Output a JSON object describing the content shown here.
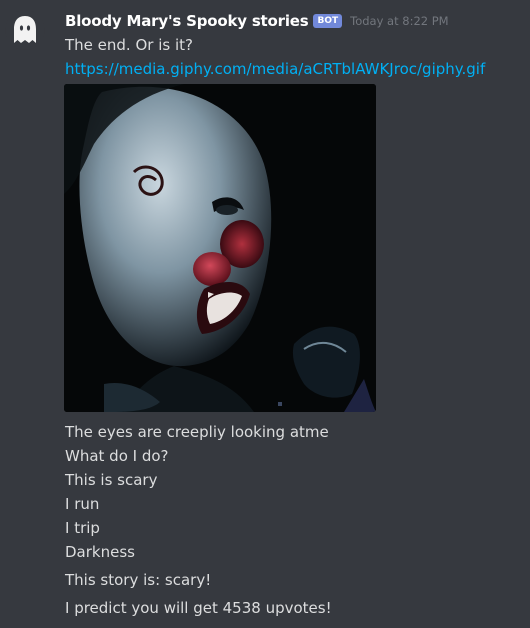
{
  "message": {
    "author": "Bloody Mary's Spooky stories",
    "bot_tag": "BOT",
    "timestamp": "Today at 8:22 PM",
    "text_line": "The end. Or is it?",
    "link": "https://media.giphy.com/media/aCRTblAWKJroc/giphy.gif",
    "story_lines": [
      "The eyes are creepliy looking atme",
      "What do I do?",
      "This is scary",
      "I run",
      "I trip",
      "Darkness"
    ],
    "verdict": "This story is: scary!",
    "prediction": "I predict you will get 4538 upvotes!"
  },
  "colors": {
    "background": "#36393f",
    "username": "#ffffff",
    "bot_tag": "#7289da",
    "timestamp": "#72767d",
    "text": "#dcddde",
    "link": "#00b0f4"
  },
  "icons": {
    "avatar": "ghost-avatar-icon"
  }
}
